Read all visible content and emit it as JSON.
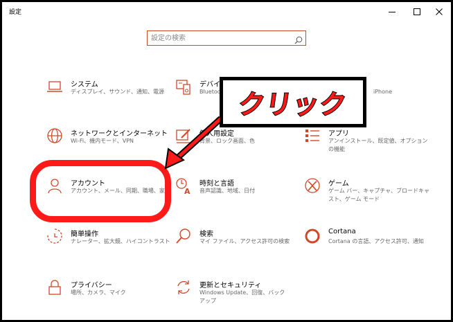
{
  "window": {
    "title": "設定",
    "minimize_icon": "minimize-icon",
    "maximize_icon": "maximize-icon",
    "close_icon": "close-icon"
  },
  "search": {
    "placeholder": "設定の検索",
    "icon": "search-icon"
  },
  "categories": [
    {
      "icon": "laptop-icon",
      "title": "システム",
      "desc": "ディスプレイ、サウンド、通知、電源"
    },
    {
      "icon": "keyboard-device-icon",
      "title": "デバイス",
      "desc": "Bluetoo"
    },
    {
      "icon": "phone-icon",
      "title": "",
      "desc": "iPhone"
    },
    {
      "icon": "globe-icon",
      "title": "ネットワークとインターネット",
      "desc": "Wi-Fi、機内モード、VPN"
    },
    {
      "icon": "paintbrush-icon",
      "title": "個人用設定",
      "desc": "背景、ロック画面、色"
    },
    {
      "icon": "apps-list-icon",
      "title": "アプリ",
      "desc": "アンインストール、既定値、オプションの機能"
    },
    {
      "icon": "person-icon",
      "title": "アカウント",
      "desc": "アカウント、メール、同期、職場、家族"
    },
    {
      "icon": "time-language-icon",
      "title": "時刻と言語",
      "desc": "音声認識、地域、日付"
    },
    {
      "icon": "xbox-icon",
      "title": "ゲーム",
      "desc": "ゲーム バー、キャプチャ、ブロードキャスト、ゲーム モード"
    },
    {
      "icon": "ease-of-access-icon",
      "title": "簡単操作",
      "desc": "ナレーター、拡大鏡、ハイコントラスト"
    },
    {
      "icon": "magnifier-icon",
      "title": "検索",
      "desc": "マイ ファイル、アクセス許可の検索"
    },
    {
      "icon": "cortana-icon",
      "title": "Cortana",
      "desc": "Cortana の言語、アクセス許可、通知"
    },
    {
      "icon": "lock-icon",
      "title": "プライバシー",
      "desc": "場所、カメラ、マイク"
    },
    {
      "icon": "sync-update-icon",
      "title": "更新とセキュリティ",
      "desc": "Windows Update、回復、バックアップ"
    }
  ],
  "annotation": {
    "callout_text": "クリック",
    "color": "#ff1a1a"
  },
  "colors": {
    "accent": "#d24726",
    "background": "#ffffff",
    "annotation": "#ff1a1a"
  }
}
